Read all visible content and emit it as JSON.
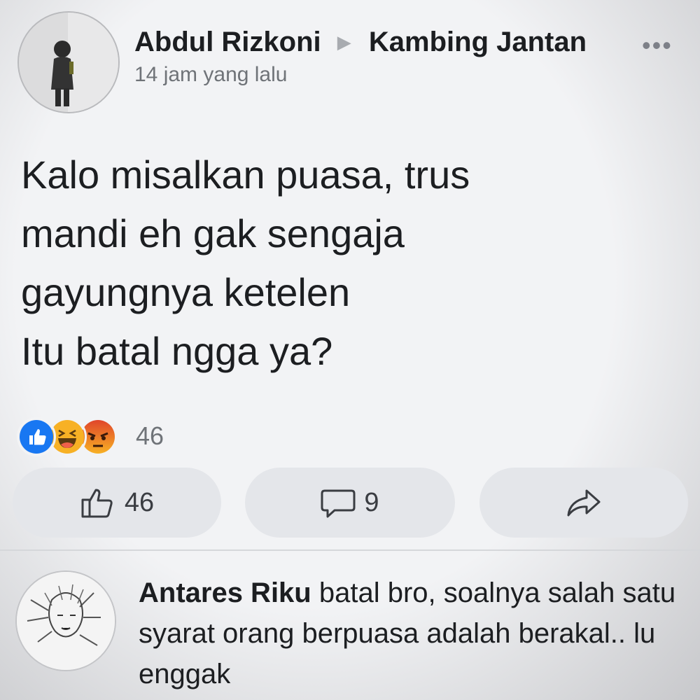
{
  "post": {
    "author": "Abdul Rizkoni",
    "target_group": "Kambing Jantan",
    "timestamp": "14 jam yang lalu",
    "text_lines": [
      "Kalo misalkan puasa, trus",
      "mandi eh gak sengaja",
      "gayungnya ketelen",
      "Itu batal ngga ya?"
    ],
    "reactions": {
      "icons": [
        "like-icon",
        "haha-icon",
        "angry-icon"
      ],
      "count": "46"
    }
  },
  "actions": {
    "like": {
      "icon": "thumbs-up-icon",
      "count": "46"
    },
    "comment": {
      "icon": "comment-bubble-icon",
      "count": "9"
    },
    "share": {
      "icon": "share-arrow-icon"
    }
  },
  "comment": {
    "author": "Antares Riku",
    "text": " batal bro, soalnya salah satu syarat orang berpuasa adalah berakal.. lu enggak"
  },
  "colors": {
    "background": "#f2f3f5",
    "button_bg": "#e4e6ea",
    "like_blue": "#1877f2",
    "haha_yellow": "#f7b125",
    "angry_orange": "#e9710f",
    "muted_text": "#6f7378"
  }
}
